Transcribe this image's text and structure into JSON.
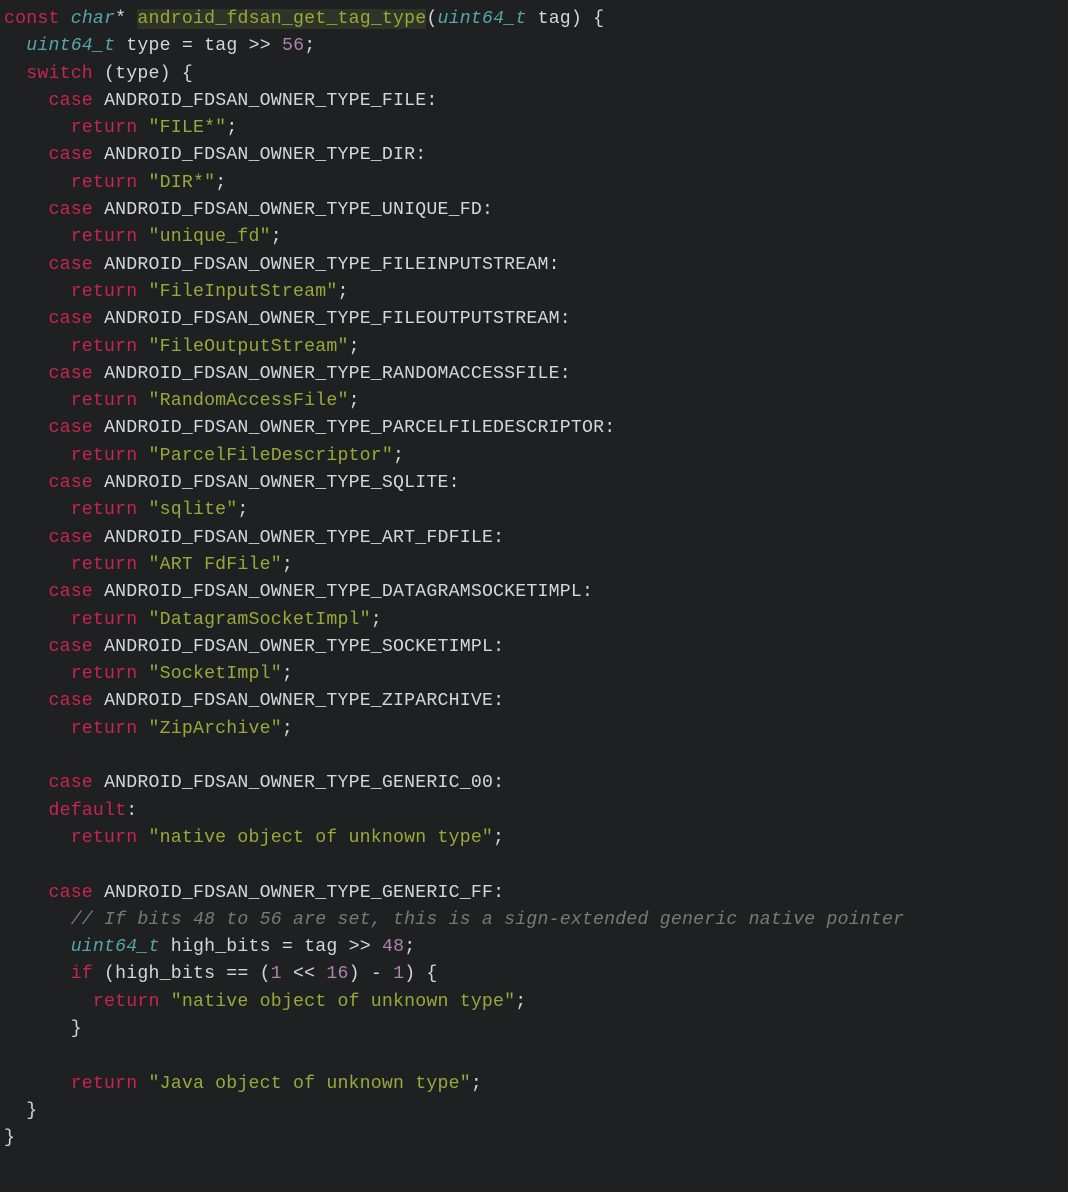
{
  "sig": {
    "kw_const": "const",
    "type_char": "char",
    "star": "*",
    "fn_name": "android_fdsan_get_tag_type",
    "param_type": "uint64_t",
    "param_name": "tag",
    "open": ") {"
  },
  "decl": {
    "type": "uint64_t",
    "name": "type",
    "eq": "=",
    "expr_lhs": "tag",
    "shift": ">>",
    "shift_amt": "56",
    "semi": ";"
  },
  "switch_kw": "switch",
  "switch_expr": "(type) {",
  "cases": [
    {
      "enum": "ANDROID_FDSAN_OWNER_TYPE_FILE",
      "ret": "\"FILE*\""
    },
    {
      "enum": "ANDROID_FDSAN_OWNER_TYPE_DIR",
      "ret": "\"DIR*\""
    },
    {
      "enum": "ANDROID_FDSAN_OWNER_TYPE_UNIQUE_FD",
      "ret": "\"unique_fd\""
    },
    {
      "enum": "ANDROID_FDSAN_OWNER_TYPE_FILEINPUTSTREAM",
      "ret": "\"FileInputStream\""
    },
    {
      "enum": "ANDROID_FDSAN_OWNER_TYPE_FILEOUTPUTSTREAM",
      "ret": "\"FileOutputStream\""
    },
    {
      "enum": "ANDROID_FDSAN_OWNER_TYPE_RANDOMACCESSFILE",
      "ret": "\"RandomAccessFile\""
    },
    {
      "enum": "ANDROID_FDSAN_OWNER_TYPE_PARCELFILEDESCRIPTOR",
      "ret": "\"ParcelFileDescriptor\""
    },
    {
      "enum": "ANDROID_FDSAN_OWNER_TYPE_SQLITE",
      "ret": "\"sqlite\""
    },
    {
      "enum": "ANDROID_FDSAN_OWNER_TYPE_ART_FDFILE",
      "ret": "\"ART FdFile\""
    },
    {
      "enum": "ANDROID_FDSAN_OWNER_TYPE_DATAGRAMSOCKETIMPL",
      "ret": "\"DatagramSocketImpl\""
    },
    {
      "enum": "ANDROID_FDSAN_OWNER_TYPE_SOCKETIMPL",
      "ret": "\"SocketImpl\""
    },
    {
      "enum": "ANDROID_FDSAN_OWNER_TYPE_ZIPARCHIVE",
      "ret": "\"ZipArchive\""
    }
  ],
  "generic00": {
    "enum": "ANDROID_FDSAN_OWNER_TYPE_GENERIC_00",
    "default_kw": "default",
    "ret": "\"native object of unknown type\""
  },
  "genericFF": {
    "enum": "ANDROID_FDSAN_OWNER_TYPE_GENERIC_FF",
    "comment": "// If bits 48 to 56 are set, this is a sign-extended generic native pointer",
    "decl_type": "uint64_t",
    "decl_name": "high_bits",
    "decl_eq": "=",
    "decl_rhs_lhs": "tag",
    "decl_shift": ">>",
    "decl_shift_amt": "48",
    "if_kw": "if",
    "cond_open": "(high_bits == (",
    "one": "1",
    "lsh": "<<",
    "sixteen": "16",
    "cond_mid": ") -",
    "one2": "1",
    "cond_close": ") {",
    "inner_ret": "\"native object of unknown type\"",
    "final_ret": "\"Java object of unknown type\""
  },
  "kw": {
    "case": "case",
    "return": "return",
    "default": "default"
  }
}
